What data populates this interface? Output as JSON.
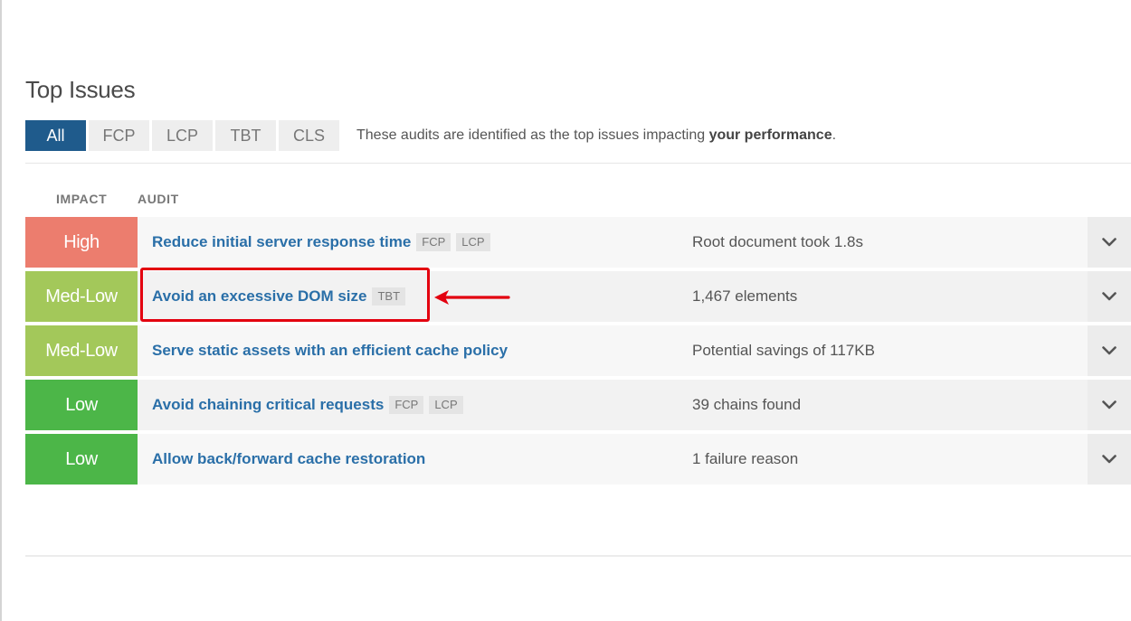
{
  "section": {
    "title": "Top Issues"
  },
  "tabs": [
    {
      "label": "All",
      "active": true
    },
    {
      "label": "FCP",
      "active": false
    },
    {
      "label": "LCP",
      "active": false
    },
    {
      "label": "TBT",
      "active": false
    },
    {
      "label": "CLS",
      "active": false
    }
  ],
  "description": {
    "text_before": "These audits are identified as the top issues impacting ",
    "emphasis": "your performance",
    "text_after": "."
  },
  "columns": {
    "impact": "IMPACT",
    "audit": "AUDIT"
  },
  "colors": {
    "tab_active": "#1f5b8c",
    "high": "#ec7d6e",
    "med_low": "#a3c85a",
    "low": "#4cb648",
    "link": "#2a6fa8",
    "annotation": "#e3000f"
  },
  "issues": [
    {
      "impact": "High",
      "impact_color": "#ec7d6e",
      "audit": "Reduce initial server response time",
      "tags": [
        "FCP",
        "LCP"
      ],
      "detail": "Root document took 1.8s",
      "expander_icon": "chevron-down-icon"
    },
    {
      "impact": "Med-Low",
      "impact_color": "#a3c85a",
      "audit": "Avoid an excessive DOM size",
      "tags": [
        "TBT"
      ],
      "detail": "1,467 elements",
      "expander_icon": "chevron-down-icon",
      "highlighted": true
    },
    {
      "impact": "Med-Low",
      "impact_color": "#a3c85a",
      "audit": "Serve static assets with an efficient cache policy",
      "tags": [],
      "detail": "Potential savings of 117KB",
      "expander_icon": "chevron-down-icon"
    },
    {
      "impact": "Low",
      "impact_color": "#4cb648",
      "audit": "Avoid chaining critical requests",
      "tags": [
        "FCP",
        "LCP"
      ],
      "detail": "39 chains found",
      "expander_icon": "chevron-down-icon"
    },
    {
      "impact": "Low",
      "impact_color": "#4cb648",
      "audit": "Allow back/forward cache restoration",
      "tags": [],
      "detail": "1 failure reason",
      "expander_icon": "chevron-down-icon"
    }
  ]
}
